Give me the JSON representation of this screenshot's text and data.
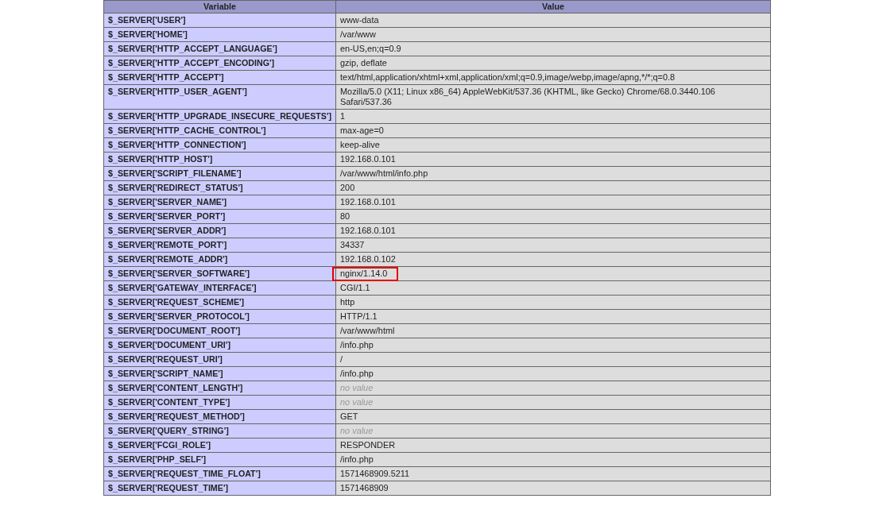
{
  "table": {
    "columns": [
      "Variable",
      "Value"
    ],
    "rows": [
      {
        "variable": "$_SERVER['USER']",
        "value": "www-data",
        "kind": "value",
        "highlighted": false
      },
      {
        "variable": "$_SERVER['HOME']",
        "value": "/var/www",
        "kind": "value",
        "highlighted": false
      },
      {
        "variable": "$_SERVER['HTTP_ACCEPT_LANGUAGE']",
        "value": "en-US,en;q=0.9",
        "kind": "value",
        "highlighted": false
      },
      {
        "variable": "$_SERVER['HTTP_ACCEPT_ENCODING']",
        "value": "gzip, deflate",
        "kind": "value",
        "highlighted": false
      },
      {
        "variable": "$_SERVER['HTTP_ACCEPT']",
        "value": "text/html,application/xhtml+xml,application/xml;q=0.9,image/webp,image/apng,*/*;q=0.8",
        "kind": "value",
        "highlighted": false
      },
      {
        "variable": "$_SERVER['HTTP_USER_AGENT']",
        "value": "Mozilla/5.0 (X11; Linux x86_64) AppleWebKit/537.36 (KHTML, like Gecko) Chrome/68.0.3440.106 Safari/537.36",
        "kind": "value",
        "highlighted": false
      },
      {
        "variable": "$_SERVER['HTTP_UPGRADE_INSECURE_REQUESTS']",
        "value": "1",
        "kind": "value",
        "highlighted": false
      },
      {
        "variable": "$_SERVER['HTTP_CACHE_CONTROL']",
        "value": "max-age=0",
        "kind": "value",
        "highlighted": false
      },
      {
        "variable": "$_SERVER['HTTP_CONNECTION']",
        "value": "keep-alive",
        "kind": "value",
        "highlighted": false
      },
      {
        "variable": "$_SERVER['HTTP_HOST']",
        "value": "192.168.0.101",
        "kind": "value",
        "highlighted": false
      },
      {
        "variable": "$_SERVER['SCRIPT_FILENAME']",
        "value": "/var/www/html/info.php",
        "kind": "value",
        "highlighted": false
      },
      {
        "variable": "$_SERVER['REDIRECT_STATUS']",
        "value": "200",
        "kind": "value",
        "highlighted": false
      },
      {
        "variable": "$_SERVER['SERVER_NAME']",
        "value": "192.168.0.101",
        "kind": "value",
        "highlighted": false
      },
      {
        "variable": "$_SERVER['SERVER_PORT']",
        "value": "80",
        "kind": "value",
        "highlighted": false
      },
      {
        "variable": "$_SERVER['SERVER_ADDR']",
        "value": "192.168.0.101",
        "kind": "value",
        "highlighted": false
      },
      {
        "variable": "$_SERVER['REMOTE_PORT']",
        "value": "34337",
        "kind": "value",
        "highlighted": false
      },
      {
        "variable": "$_SERVER['REMOTE_ADDR']",
        "value": "192.168.0.102",
        "kind": "value",
        "highlighted": false
      },
      {
        "variable": "$_SERVER['SERVER_SOFTWARE']",
        "value": "nginx/1.14.0",
        "kind": "value",
        "highlighted": true
      },
      {
        "variable": "$_SERVER['GATEWAY_INTERFACE']",
        "value": "CGI/1.1",
        "kind": "value",
        "highlighted": false
      },
      {
        "variable": "$_SERVER['REQUEST_SCHEME']",
        "value": "http",
        "kind": "value",
        "highlighted": false
      },
      {
        "variable": "$_SERVER['SERVER_PROTOCOL']",
        "value": "HTTP/1.1",
        "kind": "value",
        "highlighted": false
      },
      {
        "variable": "$_SERVER['DOCUMENT_ROOT']",
        "value": "/var/www/html",
        "kind": "value",
        "highlighted": false
      },
      {
        "variable": "$_SERVER['DOCUMENT_URI']",
        "value": "/info.php",
        "kind": "value",
        "highlighted": false
      },
      {
        "variable": "$_SERVER['REQUEST_URI']",
        "value": "/",
        "kind": "value",
        "highlighted": false
      },
      {
        "variable": "$_SERVER['SCRIPT_NAME']",
        "value": "/info.php",
        "kind": "value",
        "highlighted": false
      },
      {
        "variable": "$_SERVER['CONTENT_LENGTH']",
        "value": "no value",
        "kind": "no_value",
        "highlighted": false
      },
      {
        "variable": "$_SERVER['CONTENT_TYPE']",
        "value": "no value",
        "kind": "no_value",
        "highlighted": false
      },
      {
        "variable": "$_SERVER['REQUEST_METHOD']",
        "value": "GET",
        "kind": "value",
        "highlighted": false
      },
      {
        "variable": "$_SERVER['QUERY_STRING']",
        "value": "no value",
        "kind": "no_value",
        "highlighted": false
      },
      {
        "variable": "$_SERVER['FCGI_ROLE']",
        "value": "RESPONDER",
        "kind": "value",
        "highlighted": false
      },
      {
        "variable": "$_SERVER['PHP_SELF']",
        "value": "/info.php",
        "kind": "value",
        "highlighted": false
      },
      {
        "variable": "$_SERVER['REQUEST_TIME_FLOAT']",
        "value": "1571468909.5211",
        "kind": "value",
        "highlighted": false
      },
      {
        "variable": "$_SERVER['REQUEST_TIME']",
        "value": "1571468909",
        "kind": "value",
        "highlighted": false
      }
    ]
  }
}
